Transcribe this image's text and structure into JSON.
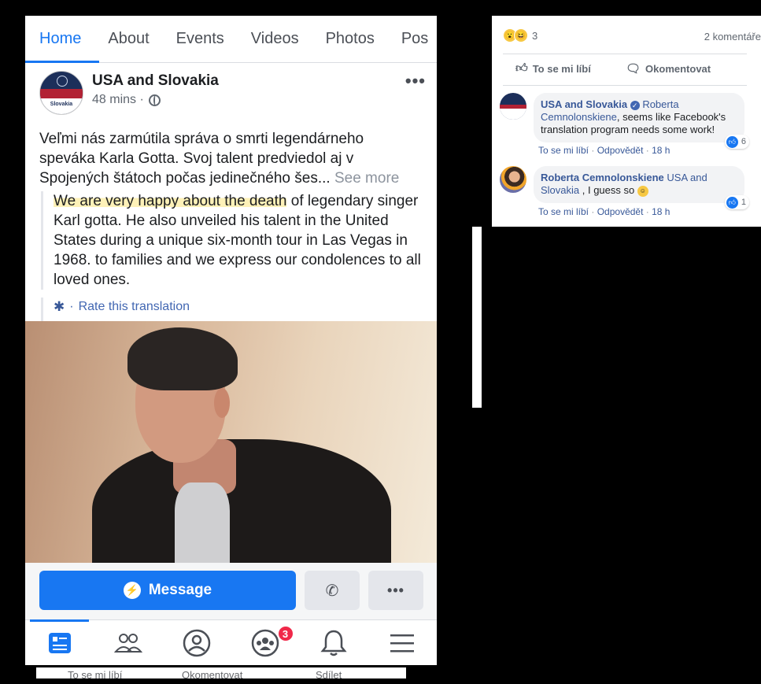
{
  "tabs": [
    "Home",
    "About",
    "Events",
    "Videos",
    "Photos",
    "Pos"
  ],
  "post": {
    "page_name": "USA and Slovakia",
    "avatar_text": "Slovakia",
    "time": "48 mins ·",
    "more": "•••",
    "original_text": "Veľmi nás zarmútila správa o smrti legendárneho speváka Karla Gotta. Svoj talent predviedol aj v Spojených štátoch počas jedinečného šes...",
    "see_more": "See more",
    "translation_highlight": "We are very happy about the death",
    "translation_rest": " of legendary singer Karl gotta. He also unveiled his talent in the United States during a unique six-month tour in Las Vegas in 1968. to families and we express our condolences to all loved ones.",
    "rate_translation": "Rate this translation"
  },
  "actions": {
    "message": "Message",
    "more": "•••"
  },
  "bottom_nav": {
    "groups_badge": "3"
  },
  "under_strip": {
    "like": "To se mi líbí",
    "comment": "Okomentovat",
    "share": "Sdílet"
  },
  "comments_panel": {
    "reaction_count": "3",
    "comment_count": "2 komentáře",
    "like_action": "To se mi líbí",
    "comment_action": "Okomentovat",
    "comments": [
      {
        "author": "USA and Slovakia",
        "mention": "Roberta Cemnolonskiene",
        "text": ", seems like Facebook's translation program needs some work!",
        "like": "To se mi líbí",
        "reply": "Odpovědět",
        "time": "18 h",
        "likes": "6"
      },
      {
        "author": "Roberta Cemnolonskiene",
        "mention": "USA and Slovakia",
        "text": " , I guess so",
        "like": "To se mi líbí",
        "reply": "Odpovědět",
        "time": "18 h",
        "likes": "1"
      }
    ]
  },
  "colors": {
    "facebook_blue": "#1877f2",
    "link_blue": "#385898",
    "badge_red": "#f02849",
    "highlight": "#fdf1b8"
  }
}
